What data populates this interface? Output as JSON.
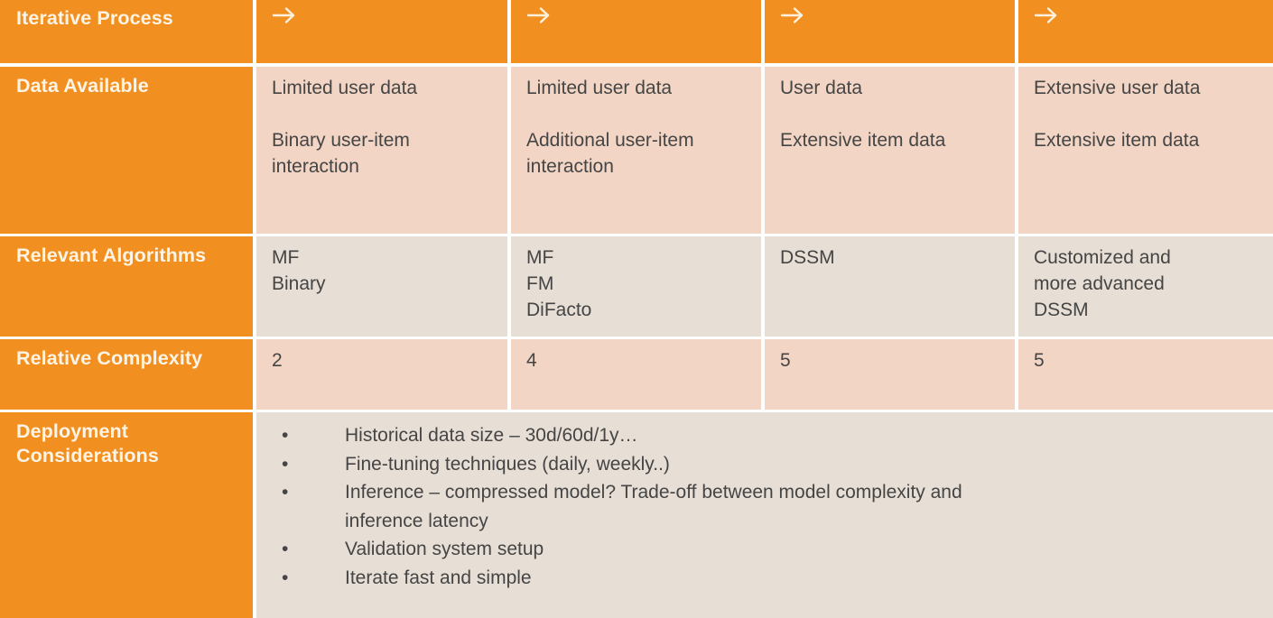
{
  "colors": {
    "orange": "#f19020",
    "label_text": "#fdf4e6",
    "cell_tone_a": "#f2d5c4",
    "cell_tone_b": "#e7ded5",
    "body_text": "#454545",
    "page_background": "#ffffff"
  },
  "table": {
    "header": {
      "row_label": "Iterative Process",
      "arrow_icon": "arrow-right-icon",
      "arrows": [
        "→",
        "→",
        "→",
        "→"
      ]
    },
    "rows": [
      {
        "label": "Data Available",
        "cells": [
          {
            "lines": [
              "Limited user data",
              "",
              "Binary user-item",
              "interaction"
            ]
          },
          {
            "lines": [
              "Limited user data",
              "",
              "Additional user-item",
              "interaction"
            ]
          },
          {
            "lines": [
              "User data",
              "",
              "Extensive item data"
            ]
          },
          {
            "lines": [
              "Extensive user data",
              "",
              "Extensive item data"
            ]
          }
        ]
      },
      {
        "label": "Relevant Algorithms",
        "label_lines": [
          "Relevant",
          "Algorithms"
        ],
        "cells": [
          {
            "lines": [
              "MF",
              "Binary"
            ]
          },
          {
            "lines": [
              "MF",
              "FM",
              "DiFacto"
            ]
          },
          {
            "lines": [
              "DSSM"
            ]
          },
          {
            "lines": [
              "Customized and",
              "more advanced",
              "DSSM"
            ]
          }
        ]
      },
      {
        "label": "Relative Complexity",
        "label_lines": [
          "Relative",
          "Complexity"
        ],
        "cells": [
          {
            "lines": [
              "2"
            ]
          },
          {
            "lines": [
              "4"
            ]
          },
          {
            "lines": [
              "5"
            ]
          },
          {
            "lines": [
              "5"
            ]
          }
        ]
      }
    ],
    "footer_row": {
      "label": "Deployment Considerations",
      "label_lines": [
        "Deployment",
        "Considerations"
      ],
      "bullet_marker": "•",
      "bullets": [
        {
          "text": "Historical data size – 30d/60d/1y…",
          "continuation": ""
        },
        {
          "text": "Fine-tuning techniques (daily, weekly..)",
          "continuation": ""
        },
        {
          "text": "Inference – compressed model? Trade-off between model complexity and",
          "continuation": "inference latency"
        },
        {
          "text": "Validation system setup",
          "continuation": ""
        },
        {
          "text": "Iterate fast and simple",
          "continuation": ""
        }
      ]
    }
  }
}
